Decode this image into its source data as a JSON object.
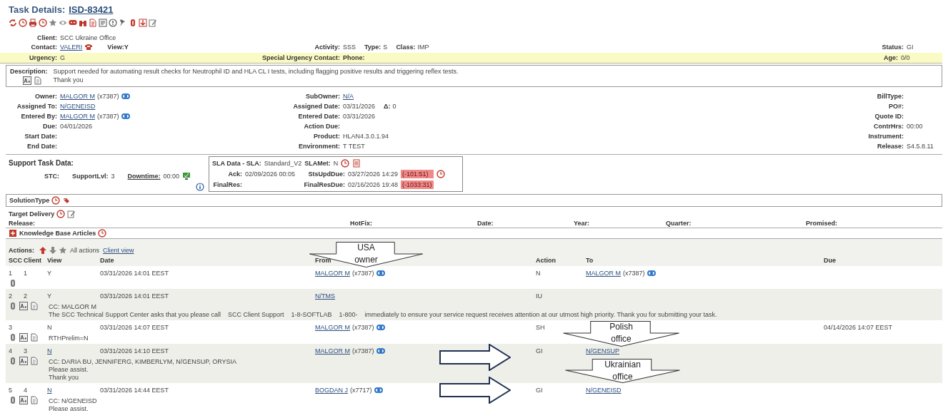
{
  "title": {
    "label": "Task Details:",
    "task_id": "ISD-83421"
  },
  "client": {
    "label": "Client:",
    "value": "SCC Ukraine Office"
  },
  "contact": {
    "label": "Contact:",
    "value": "VALERI",
    "link": true,
    "view": "View:Y"
  },
  "activity": [
    {
      "label": "Activity:",
      "value": "SSS"
    },
    {
      "label": "Type:",
      "value": "S"
    },
    {
      "label": "Class:",
      "value": "IMP"
    }
  ],
  "status": {
    "label": "Status:",
    "value": "GI"
  },
  "urgency_bar": {
    "urgency": {
      "label": "Urgency:",
      "value": "G"
    },
    "special": {
      "label": "Special Urgency Contact:"
    },
    "phone": {
      "label": "Phone:"
    },
    "age": {
      "label": "Age:",
      "value": "0/0"
    }
  },
  "description": {
    "label": "Description:",
    "lines": [
      "Support needed for automating result checks for Neutrophil ID and HLA CL I tests, including flagging positive results and triggering reflex tests.",
      "Thank you"
    ]
  },
  "details": [
    {
      "left": {
        "label": "Owner:",
        "value": "MALGOR M",
        "link": true,
        "ext": "(x7387)",
        "contact_icon": true
      },
      "mid": {
        "label": "SubOwner:",
        "value": "N/A",
        "link": true
      },
      "right": {
        "label": "BillType:"
      }
    },
    {
      "left": {
        "label": "Assigned To:",
        "value": "N/GENEISD",
        "link": true
      },
      "mid": {
        "label": "Assigned Date:",
        "value": "03/31/2026",
        "delta": {
          "label": "Δ:",
          "value": "0"
        }
      },
      "right": {
        "label": "PO#:"
      }
    },
    {
      "left": {
        "label": "Entered By:",
        "value": "MALGOR M",
        "link": true,
        "ext": "(x7387)",
        "contact_icon": true
      },
      "mid": {
        "label": "Entered Date:",
        "value": "03/31/2026"
      },
      "right": {
        "label": "Quote ID:"
      }
    },
    {
      "left": {
        "label": "Due:",
        "value": "04/01/2026"
      },
      "mid": {
        "label": "Action Due:"
      },
      "right": {
        "label": "ContrHrs:",
        "value": "00:00"
      }
    },
    {
      "left": {
        "label": "Start Date:"
      },
      "mid": {
        "label": "Product:",
        "value": "HLAN4.3.0.1.94"
      },
      "right": {
        "label": "Instrument:"
      }
    },
    {
      "left": {
        "label": "End Date:"
      },
      "mid": {
        "label": "Environment:",
        "value": "T TEST"
      },
      "right": {
        "label": "Release:",
        "value": "S4.5.8.11"
      }
    }
  ],
  "support": {
    "title": "Support Task Data:",
    "stc": "STC:",
    "support_lvl": {
      "label": "SupportLvl:",
      "value": "3"
    },
    "downtime": {
      "label": "Downtime:",
      "value": "00:00"
    }
  },
  "sla": {
    "title": "SLA Data - SLA:",
    "sla": "Standard_V2",
    "met": {
      "label": "SLAMet:",
      "value": "N"
    },
    "rows": [
      {
        "label": "Ack:",
        "value": "02/09/2026  00:05",
        "due_label": "StsUpdDue:",
        "due": "03/27/2026 14:29",
        "overdue": "(-101:51)",
        "clock_icon": true
      },
      {
        "label": "FinalRes:",
        "due_label": "FinalResDue:",
        "due": "02/16/2026 19:48",
        "overdue": "(-1033:31)",
        "clock_icon": false
      }
    ]
  },
  "solution_type": "SolutionType",
  "target_delivery": "Target Delivery",
  "delivery_fields": [
    "Release:",
    "HotFix:",
    "Date:",
    "Year:",
    "Quarter:",
    "Promised:"
  ],
  "kb": {
    "label": "Knowledge Base Articles",
    "expanded": false
  },
  "actions": {
    "label": "Actions:",
    "all_actions": "All actions",
    "client_view": "Client view",
    "columns": [
      "SCC",
      "Client",
      "View",
      "Date",
      "From",
      "Action",
      "To",
      "Due"
    ],
    "rows": [
      {
        "scc": "1",
        "client": "1",
        "view": "Y",
        "view_link": false,
        "date": "03/31/2026 14:01 EEST",
        "from": {
          "value": "MALGOR M",
          "link": true,
          "ext": "(x7387)",
          "contact_icon": true
        },
        "action": "N",
        "to": {
          "value": "MALGOR M",
          "link": true,
          "ext": "(x7387)",
          "contact_icon": true
        },
        "notes": []
      },
      {
        "scc": "2",
        "client": "2",
        "view": "Y",
        "view_link": false,
        "date": "03/31/2026 14:01 EEST",
        "from": {
          "value": "N/TMS",
          "link": true
        },
        "action": "IU",
        "notes": [
          {
            "kind": "text",
            "text": "CC: MALGOR M"
          },
          {
            "kind": "message",
            "parts": [
              {
                "kind": "text",
                "text": "The SCC Technical Support Center asks that you please call"
              },
              {
                "kind": "text",
                "text": "SCC Client Support"
              },
              {
                "kind": "text",
                "text": "1-8"
              },
              {
                "kind": "redacted"
              },
              {
                "kind": "text",
                "text": "-SOFTLAB"
              },
              {
                "kind": "text",
                "text": "1-800-"
              },
              {
                "kind": "redacted"
              },
              {
                "kind": "text",
                "text": "immediately to ensure your service request receives attention at our utmost high priority. Thank you for submitting your task."
              }
            ]
          }
        ]
      },
      {
        "scc": "3",
        "view": "N",
        "view_link": false,
        "date": "03/31/2026 14:07 EEST",
        "from": {
          "value": "MALGOR M",
          "link": true,
          "ext": "(x7387)",
          "contact_icon": true
        },
        "action": "SH",
        "due": "04/14/2026 14:07 EEST",
        "notes": [
          {
            "kind": "text",
            "text": "RTHPrelim=N"
          }
        ]
      },
      {
        "scc": "4",
        "client": "3",
        "view": "N",
        "view_link": true,
        "date": "03/31/2026 14:10 EEST",
        "from": {
          "value": "MALGOR M",
          "link": true,
          "ext": "(x7387)",
          "contact_icon": true
        },
        "action": "GI",
        "to": {
          "value": "N/GENSUP",
          "link": true
        },
        "notes": [
          {
            "kind": "text",
            "text": "CC: DARIA BU, JENNIFERG, KIMBERLYM, N/GENSUP, ORYSIA"
          },
          {
            "kind": "text",
            "text": "Please assist."
          },
          {
            "kind": "text",
            "text": "Thank  you"
          }
        ]
      },
      {
        "scc": "5",
        "client": "4",
        "view": "N",
        "view_link": true,
        "date": "03/31/2026 14:44 EEST",
        "from": {
          "value": "BOGDAN J",
          "link": true,
          "ext": "(x7717)",
          "contact_icon": true
        },
        "action": "GI",
        "to": {
          "value": "N/GENEISD",
          "link": true
        },
        "notes": [
          {
            "kind": "text",
            "text": "CC: N/GENEISD"
          },
          {
            "kind": "text",
            "text": "Please assist."
          }
        ]
      }
    ]
  },
  "annotations": [
    {
      "kind": "callout",
      "lines": [
        "USA",
        "owner"
      ]
    },
    {
      "kind": "callout",
      "lines": [
        "Polish",
        "office"
      ]
    },
    {
      "kind": "callout",
      "lines": [
        "Ukrainian",
        "office"
      ]
    },
    {
      "kind": "arrow"
    },
    {
      "kind": "arrow"
    }
  ]
}
